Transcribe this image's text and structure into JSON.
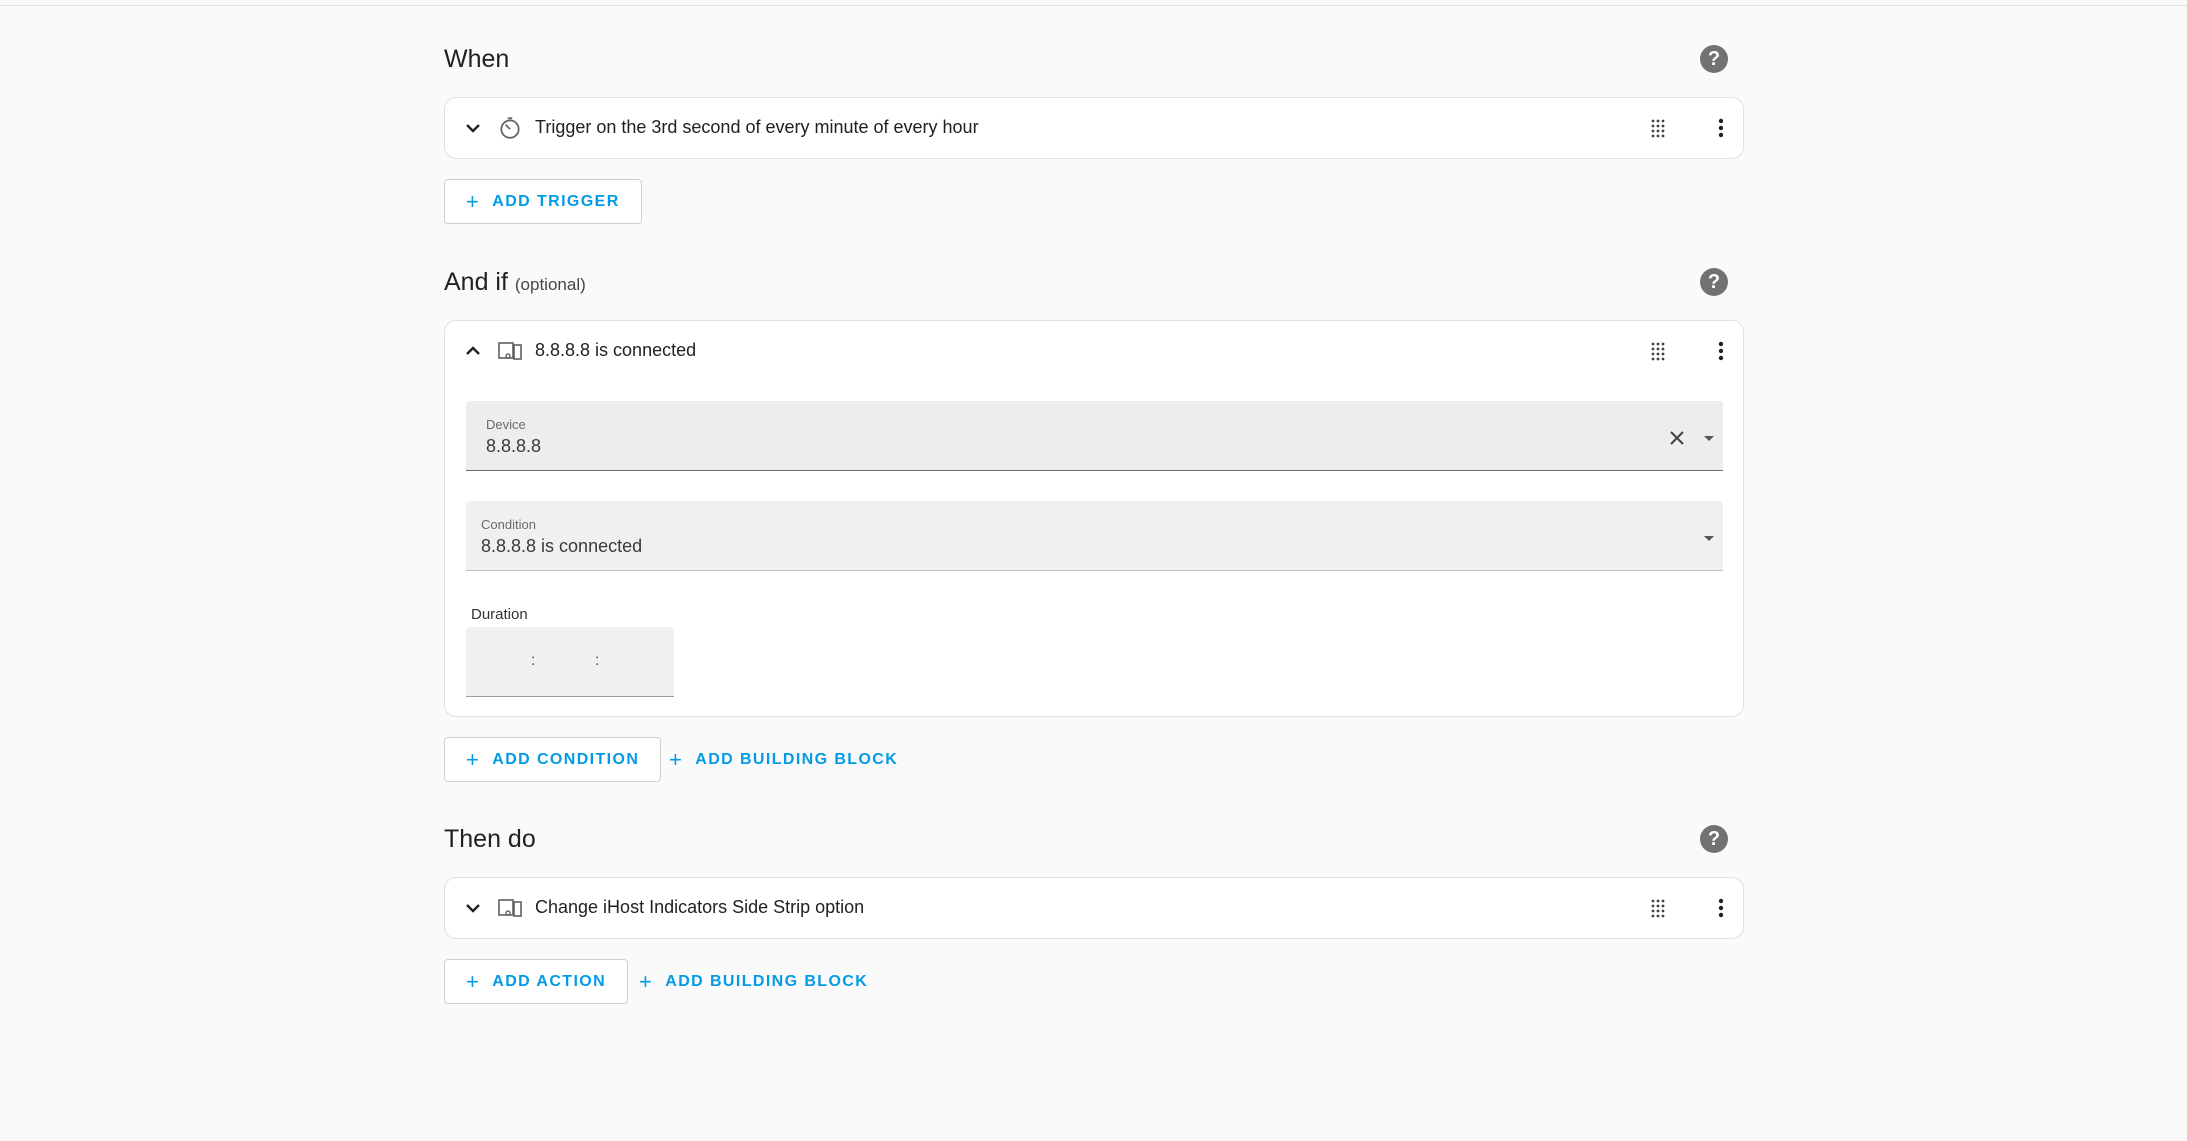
{
  "when": {
    "title": "When",
    "trigger": {
      "title": "Trigger on the 3rd second of every minute of every hour",
      "icon": "timer-icon"
    },
    "add_trigger_label": "ADD TRIGGER"
  },
  "and_if": {
    "title": "And if",
    "optional": "(optional)",
    "condition": {
      "title": "8.8.8.8 is connected",
      "icon": "device-icon",
      "device_label": "Device",
      "device_value": "8.8.8.8",
      "condition_label": "Condition",
      "condition_value": "8.8.8.8 is connected",
      "duration_label": "Duration",
      "duration_separator": ":"
    },
    "add_condition_label": "ADD CONDITION",
    "add_block_label": "ADD BUILDING BLOCK"
  },
  "then_do": {
    "title": "Then do",
    "action": {
      "title": "Change iHost Indicators Side Strip option",
      "icon": "device-icon"
    },
    "add_action_label": "ADD ACTION",
    "add_block_label": "ADD BUILDING BLOCK"
  },
  "colors": {
    "accent": "#039be5",
    "help_icon": "#727272",
    "background": "#fafafa"
  }
}
